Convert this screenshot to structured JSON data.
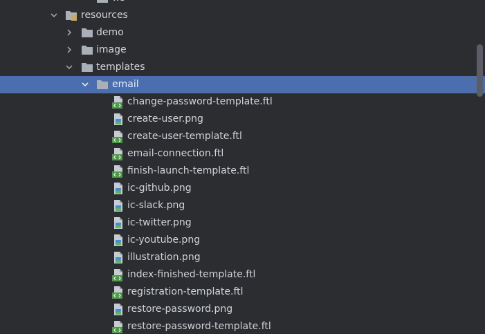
{
  "tree": {
    "partial_top_label": "ws",
    "items": [
      {
        "label": "resources",
        "kind": "resources-folder",
        "level": 0,
        "expanded": true
      },
      {
        "label": "demo",
        "kind": "folder",
        "level": 1,
        "expanded": false
      },
      {
        "label": "image",
        "kind": "folder",
        "level": 1,
        "expanded": false
      },
      {
        "label": "templates",
        "kind": "folder",
        "level": 1,
        "expanded": true
      },
      {
        "label": "email",
        "kind": "folder",
        "level": 2,
        "expanded": true,
        "selected": true
      },
      {
        "label": "change-password-template.ftl",
        "kind": "ftl-file",
        "level": 3
      },
      {
        "label": "create-user.png",
        "kind": "png-file",
        "level": 3
      },
      {
        "label": "create-user-template.ftl",
        "kind": "ftl-file",
        "level": 3
      },
      {
        "label": "email-connection.ftl",
        "kind": "ftl-file",
        "level": 3
      },
      {
        "label": "finish-launch-template.ftl",
        "kind": "ftl-file",
        "level": 3
      },
      {
        "label": "ic-github.png",
        "kind": "png-file",
        "level": 3
      },
      {
        "label": "ic-slack.png",
        "kind": "png-file",
        "level": 3
      },
      {
        "label": "ic-twitter.png",
        "kind": "png-file",
        "level": 3
      },
      {
        "label": "ic-youtube.png",
        "kind": "png-file",
        "level": 3
      },
      {
        "label": "illustration.png",
        "kind": "png-file",
        "level": 3
      },
      {
        "label": "index-finished-template.ftl",
        "kind": "ftl-file",
        "level": 3
      },
      {
        "label": "registration-template.ftl",
        "kind": "ftl-file",
        "level": 3
      },
      {
        "label": "restore-password.png",
        "kind": "png-file",
        "level": 3
      },
      {
        "label": "restore-password-template.ftl",
        "kind": "ftl-file",
        "level": 3
      }
    ]
  },
  "colors": {
    "background": "#2b2d30",
    "selection": "#4b6eaf",
    "text": "#d0d3d8",
    "folder": "#a9b0b8",
    "ftl_green": "#4f9a4a",
    "png_blue": "#3d8fd6"
  }
}
